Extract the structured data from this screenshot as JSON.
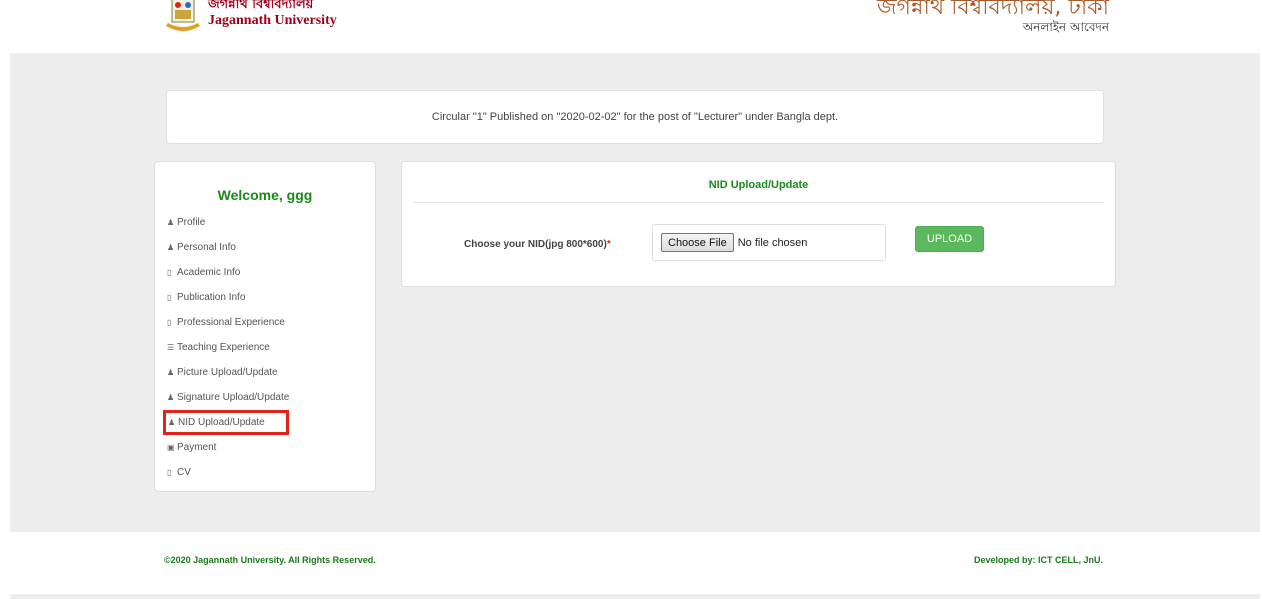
{
  "header": {
    "logo_bn": "জগন্নাথ বিশ্ববিদ্যালয়",
    "logo_en": "Jagannath University",
    "title": "জগন্নাথ বিশ্ববিদ্যালয়, ঢাকা",
    "subtitle": "অনলাইন আবেদন"
  },
  "circular": {
    "text": "Circular \"1\" Published on \"2020-02-02\" for the post of \"Lecturer\" under Bangla dept."
  },
  "sidebar": {
    "welcome": "Welcome, ggg",
    "items": [
      {
        "label": "Profile",
        "icon": "user-icon"
      },
      {
        "label": "Personal Info",
        "icon": "user-icon"
      },
      {
        "label": "Academic Info",
        "icon": "book-icon"
      },
      {
        "label": "Publication Info",
        "icon": "book-icon"
      },
      {
        "label": "Professional Experience",
        "icon": "book-icon"
      },
      {
        "label": "Teaching Experience",
        "icon": "list-icon"
      },
      {
        "label": "Picture Upload/Update",
        "icon": "user-icon"
      },
      {
        "label": "Signature Upload/Update",
        "icon": "user-icon"
      },
      {
        "label": "NID Upload/Update",
        "icon": "user-icon",
        "active": true
      },
      {
        "label": "Payment",
        "icon": "money-icon"
      },
      {
        "label": "CV",
        "icon": "book-icon"
      }
    ]
  },
  "panel": {
    "title": "NID Upload/Update",
    "choose_label": "Choose your NID(jpg 800*600)",
    "required_mark": "*",
    "file_button": "Choose File",
    "file_status": "No file chosen",
    "upload_button": "UPLOAD"
  },
  "footer": {
    "copyright": "©2020 Jagannath University. All Rights Reserved.",
    "developer": "Developed by: ICT CELL, JnU."
  },
  "colors": {
    "accent_green": "#1a8a1a",
    "button_green": "#5cb85c",
    "highlight_red": "#e2231a",
    "title_brown": "#a85a2a"
  }
}
